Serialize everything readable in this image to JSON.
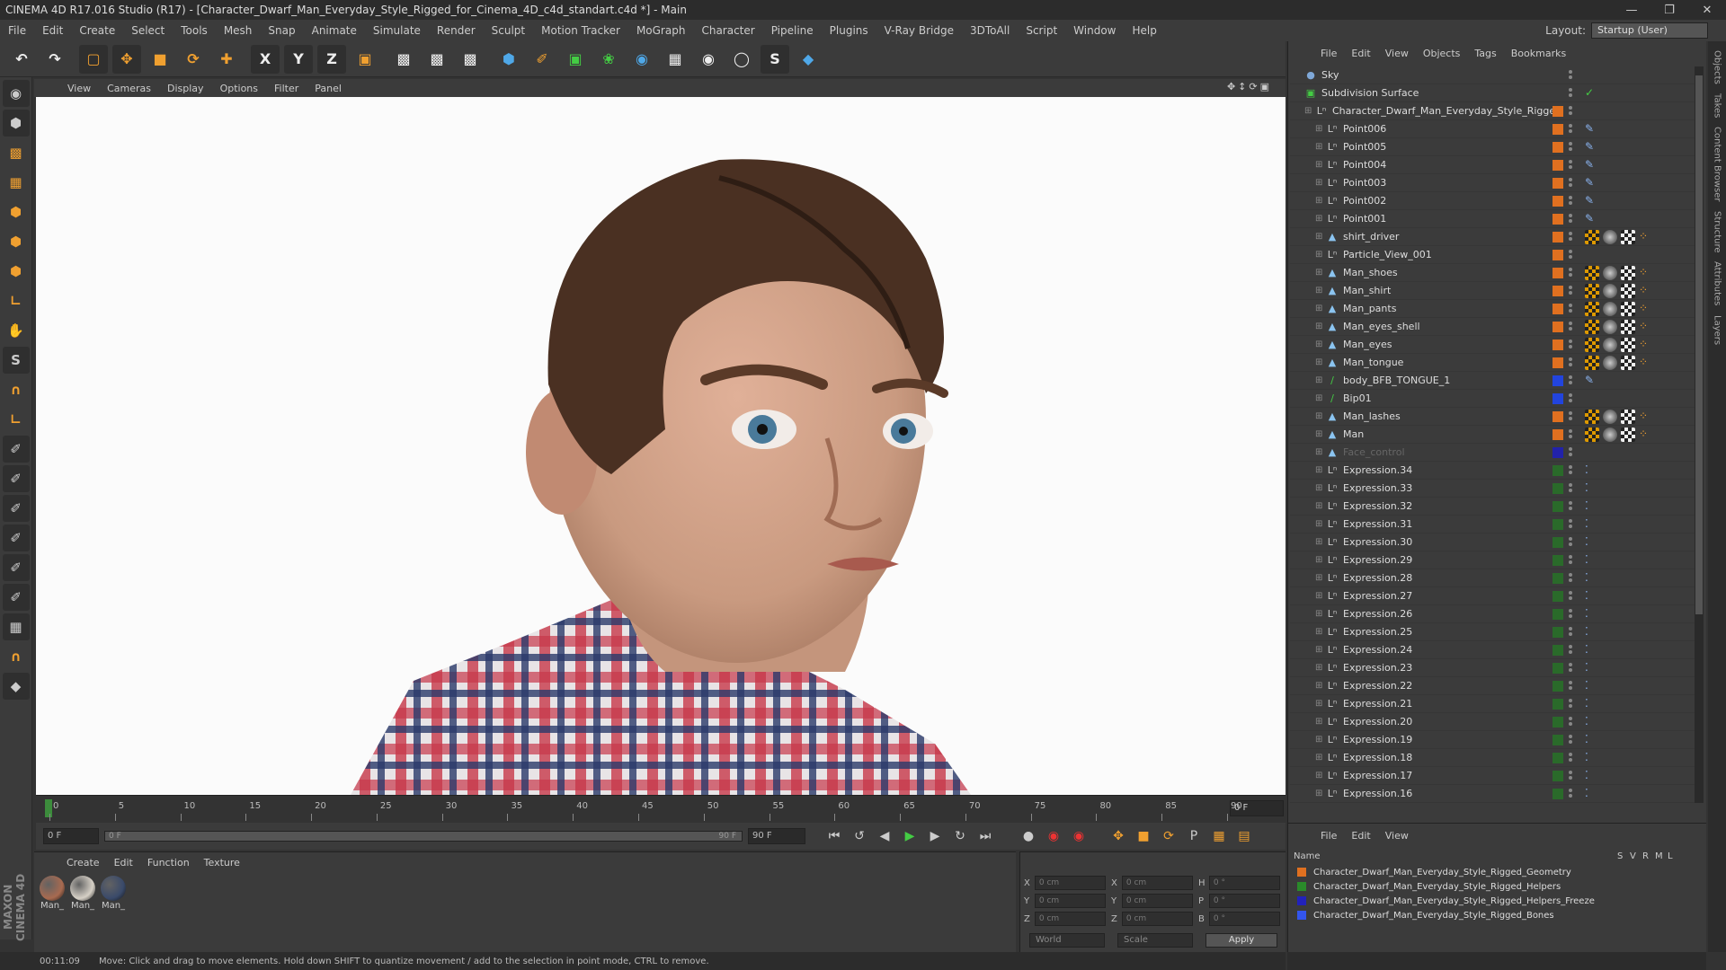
{
  "window": {
    "title": "CINEMA 4D R17.016 Studio (R17) - [Character_Dwarf_Man_Everyday_Style_Rigged_for_Cinema_4D_c4d_standart.c4d *] - Main"
  },
  "menu": [
    "File",
    "Edit",
    "Create",
    "Select",
    "Tools",
    "Mesh",
    "Snap",
    "Animate",
    "Simulate",
    "Render",
    "Sculpt",
    "Motion Tracker",
    "MoGraph",
    "Character",
    "Pipeline",
    "Plugins",
    "V-Ray Bridge",
    "3DToAll",
    "Script",
    "Window",
    "Help"
  ],
  "layout": {
    "label": "Layout:",
    "value": "Startup (User)"
  },
  "toolbar": {
    "x": "X",
    "y": "Y",
    "z": "Z"
  },
  "viewport": {
    "menu": [
      "View",
      "Cameras",
      "Display",
      "Options",
      "Filter",
      "Panel"
    ]
  },
  "timeline": {
    "ticks": [
      "0",
      "5",
      "10",
      "15",
      "20",
      "25",
      "30",
      "35",
      "40",
      "45",
      "50",
      "55",
      "60",
      "65",
      "70",
      "75",
      "80",
      "85",
      "90"
    ],
    "frame": "0 F"
  },
  "transport": {
    "start": "0 F",
    "scrub_start": "0 F",
    "scrub_end": "90 F",
    "end": "90 F"
  },
  "material": {
    "menu": [
      "Create",
      "Edit",
      "Function",
      "Texture"
    ],
    "items": [
      {
        "name": "Man_",
        "color": "#a86a50"
      },
      {
        "name": "Man_",
        "color": "#d6d0c6"
      },
      {
        "name": "Man_",
        "color": "#3a4a6a"
      }
    ]
  },
  "coords": {
    "rows": [
      [
        "X",
        "0 cm",
        "X",
        "0 cm",
        "H",
        "0 °"
      ],
      [
        "Y",
        "0 cm",
        "Y",
        "0 cm",
        "P",
        "0 °"
      ],
      [
        "Z",
        "0 cm",
        "Z",
        "0 cm",
        "B",
        "0 °"
      ]
    ],
    "world": "World",
    "scale": "Scale",
    "apply": "Apply"
  },
  "status": {
    "time": "00:11:09",
    "message": "Move: Click and drag to move elements. Hold down SHIFT to quantize movement / add to the selection in point mode, CTRL to remove."
  },
  "objects": {
    "menu": [
      "File",
      "Edit",
      "View",
      "Objects",
      "Tags",
      "Bookmarks"
    ],
    "rows": [
      {
        "name": "Sky",
        "depth": 0,
        "icon": "sky",
        "layer": "",
        "tags": ""
      },
      {
        "name": "Subdivision Surface",
        "depth": 0,
        "icon": "subd",
        "layer": "",
        "tags": "check"
      },
      {
        "name": "Character_Dwarf_Man_Everyday_Style_Rigged",
        "depth": 1,
        "icon": "null",
        "layer": "#e07020",
        "tags": ""
      },
      {
        "name": "Point006",
        "depth": 2,
        "icon": "null",
        "layer": "#e07020",
        "tags": "pin"
      },
      {
        "name": "Point005",
        "depth": 2,
        "icon": "null",
        "layer": "#e07020",
        "tags": "pin"
      },
      {
        "name": "Point004",
        "depth": 2,
        "icon": "null",
        "layer": "#e07020",
        "tags": "pin"
      },
      {
        "name": "Point003",
        "depth": 2,
        "icon": "null",
        "layer": "#e07020",
        "tags": "pin"
      },
      {
        "name": "Point002",
        "depth": 2,
        "icon": "null",
        "layer": "#e07020",
        "tags": "pin"
      },
      {
        "name": "Point001",
        "depth": 2,
        "icon": "null",
        "layer": "#e07020",
        "tags": "pin"
      },
      {
        "name": "shirt_driver",
        "depth": 2,
        "icon": "mesh",
        "layer": "#e07020",
        "tags": "mat"
      },
      {
        "name": "Particle_View_001",
        "depth": 2,
        "icon": "null",
        "layer": "#e07020",
        "tags": ""
      },
      {
        "name": "Man_shoes",
        "depth": 2,
        "icon": "mesh",
        "layer": "#e07020",
        "tags": "mat"
      },
      {
        "name": "Man_shirt",
        "depth": 2,
        "icon": "mesh",
        "layer": "#e07020",
        "tags": "mat"
      },
      {
        "name": "Man_pants",
        "depth": 2,
        "icon": "mesh",
        "layer": "#e07020",
        "tags": "mat"
      },
      {
        "name": "Man_eyes_shell",
        "depth": 2,
        "icon": "mesh",
        "layer": "#e07020",
        "tags": "mat"
      },
      {
        "name": "Man_eyes",
        "depth": 2,
        "icon": "mesh",
        "layer": "#e07020",
        "tags": "mat"
      },
      {
        "name": "Man_tongue",
        "depth": 2,
        "icon": "mesh",
        "layer": "#e07020",
        "tags": "mat"
      },
      {
        "name": "body_BFB_TONGUE_1",
        "depth": 2,
        "icon": "bone",
        "layer": "#2244dd",
        "tags": "pin"
      },
      {
        "name": "Bip01",
        "depth": 2,
        "icon": "bone",
        "layer": "#2244dd",
        "tags": ""
      },
      {
        "name": "Man_lashes",
        "depth": 2,
        "icon": "mesh",
        "layer": "#e07020",
        "tags": "mat"
      },
      {
        "name": "Man",
        "depth": 2,
        "icon": "mesh",
        "layer": "#e07020",
        "tags": "mat"
      },
      {
        "name": "Face_control",
        "depth": 2,
        "icon": "mesh",
        "layer": "#2222aa",
        "tags": "",
        "dim": true
      },
      {
        "name": "Expression.34",
        "depth": 2,
        "icon": "null",
        "layer": "#2a6a2a",
        "tags": "expr"
      },
      {
        "name": "Expression.33",
        "depth": 2,
        "icon": "null",
        "layer": "#2a6a2a",
        "tags": "expr"
      },
      {
        "name": "Expression.32",
        "depth": 2,
        "icon": "null",
        "layer": "#2a6a2a",
        "tags": "expr"
      },
      {
        "name": "Expression.31",
        "depth": 2,
        "icon": "null",
        "layer": "#2a6a2a",
        "tags": "expr"
      },
      {
        "name": "Expression.30",
        "depth": 2,
        "icon": "null",
        "layer": "#2a6a2a",
        "tags": "expr"
      },
      {
        "name": "Expression.29",
        "depth": 2,
        "icon": "null",
        "layer": "#2a6a2a",
        "tags": "expr"
      },
      {
        "name": "Expression.28",
        "depth": 2,
        "icon": "null",
        "layer": "#2a6a2a",
        "tags": "expr"
      },
      {
        "name": "Expression.27",
        "depth": 2,
        "icon": "null",
        "layer": "#2a6a2a",
        "tags": "expr"
      },
      {
        "name": "Expression.26",
        "depth": 2,
        "icon": "null",
        "layer": "#2a6a2a",
        "tags": "expr"
      },
      {
        "name": "Expression.25",
        "depth": 2,
        "icon": "null",
        "layer": "#2a6a2a",
        "tags": "expr"
      },
      {
        "name": "Expression.24",
        "depth": 2,
        "icon": "null",
        "layer": "#2a6a2a",
        "tags": "expr"
      },
      {
        "name": "Expression.23",
        "depth": 2,
        "icon": "null",
        "layer": "#2a6a2a",
        "tags": "expr"
      },
      {
        "name": "Expression.22",
        "depth": 2,
        "icon": "null",
        "layer": "#2a6a2a",
        "tags": "expr"
      },
      {
        "name": "Expression.21",
        "depth": 2,
        "icon": "null",
        "layer": "#2a6a2a",
        "tags": "expr"
      },
      {
        "name": "Expression.20",
        "depth": 2,
        "icon": "null",
        "layer": "#2a6a2a",
        "tags": "expr"
      },
      {
        "name": "Expression.19",
        "depth": 2,
        "icon": "null",
        "layer": "#2a6a2a",
        "tags": "expr"
      },
      {
        "name": "Expression.18",
        "depth": 2,
        "icon": "null",
        "layer": "#2a6a2a",
        "tags": "expr"
      },
      {
        "name": "Expression.17",
        "depth": 2,
        "icon": "null",
        "layer": "#2a6a2a",
        "tags": "expr"
      },
      {
        "name": "Expression.16",
        "depth": 2,
        "icon": "null",
        "layer": "#2a6a2a",
        "tags": "expr"
      }
    ]
  },
  "layers": {
    "menu": [
      "File",
      "Edit",
      "View"
    ],
    "cols": [
      "Name",
      "S",
      "V",
      "R",
      "M",
      "L"
    ],
    "rows": [
      {
        "name": "Character_Dwarf_Man_Everyday_Style_Rigged_Geometry",
        "color": "#e07020"
      },
      {
        "name": "Character_Dwarf_Man_Everyday_Style_Rigged_Helpers",
        "color": "#2a8a2a"
      },
      {
        "name": "Character_Dwarf_Man_Everyday_Style_Rigged_Helpers_Freeze",
        "color": "#2222bb"
      },
      {
        "name": "Character_Dwarf_Man_Everyday_Style_Rigged_Bones",
        "color": "#3355ee"
      }
    ]
  },
  "sidetabs": [
    "Objects",
    "Takes",
    "Content Browser",
    "Structure",
    "Attributes",
    "Layers"
  ],
  "maxon": "MAXON CINEMA 4D"
}
